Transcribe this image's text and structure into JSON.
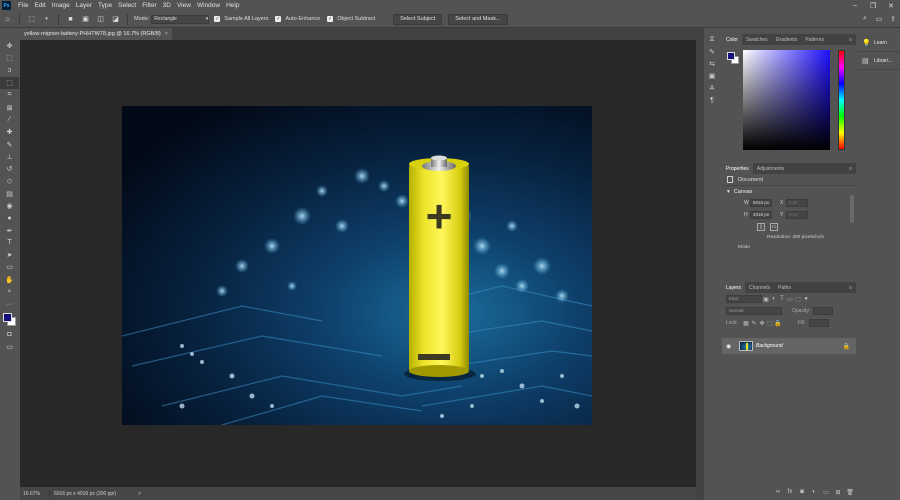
{
  "app": {
    "logo": "Ps"
  },
  "menu": [
    "File",
    "Edit",
    "Image",
    "Layer",
    "Type",
    "Select",
    "Filter",
    "3D",
    "View",
    "Window",
    "Help"
  ],
  "options": {
    "mode_label": "Mode:",
    "mode_value": "Rectangle",
    "sample_all_layers": "Sample All Layers",
    "auto_enhance": "Auto-Enhance",
    "object_subtract": "Object Subtract",
    "select_subject": "Select Subject",
    "select_and_mask": "Select and Mask..."
  },
  "document": {
    "tab_title": "yellow-mignon-battery-PHHTW78.jpg @ 16.7% (RGB/8)",
    "close": "×",
    "battery_plus": "+",
    "battery_minus": "–"
  },
  "status": {
    "zoom": "16.67%",
    "info": "6016 px x 4016 px (300 ppi)",
    "arrow": ">"
  },
  "color_panel": {
    "tabs": [
      "Color",
      "Swatches",
      "Gradients",
      "Patterns"
    ],
    "foreground": "#12127a",
    "background": "#ffffff"
  },
  "properties": {
    "tabs": [
      "Properties",
      "Adjustments"
    ],
    "doc_label": "Document",
    "canvas_label": "Canvas",
    "w_label": "W",
    "w_value": "6016 px",
    "h_label": "H",
    "h_value": "4016 px",
    "x_label": "X",
    "x_value": "0 px",
    "y_label": "Y",
    "y_value": "0 px",
    "resolution": "Resolution: 300 pixels/inch",
    "mode": "Mode"
  },
  "layers": {
    "tabs": [
      "Layers",
      "Channels",
      "Paths"
    ],
    "kind_placeholder": "Kind",
    "blend": "Normal",
    "opacity_label": "Opacity:",
    "lock_label": "Lock:",
    "fill_label": "Fill:",
    "layer_name": "Background"
  },
  "learn": {
    "items": [
      "Learn",
      "Librari..."
    ]
  },
  "win_controls": [
    "–",
    "❐",
    "✕"
  ]
}
